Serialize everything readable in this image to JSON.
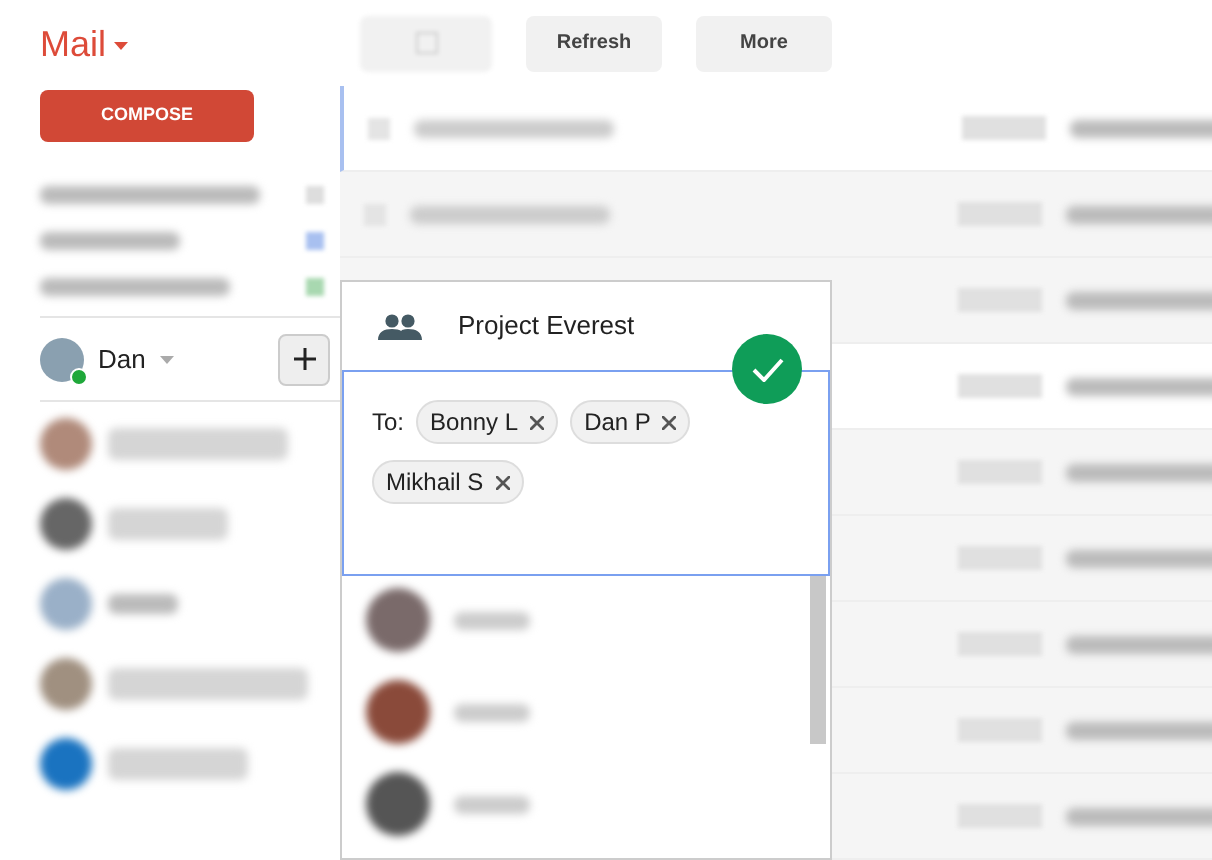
{
  "app": {
    "title": "Mail"
  },
  "compose_button": "COMPOSE",
  "toolbar": {
    "buttons": [
      "Refresh",
      "More"
    ]
  },
  "chat": {
    "user": {
      "name": "Dan",
      "online": true
    }
  },
  "group_popup": {
    "title": "Project Everest",
    "to_label": "To:",
    "confirmed": true,
    "recipients": [
      {
        "name": "Bonny L"
      },
      {
        "name": "Dan P"
      },
      {
        "name": "Mikhail S"
      }
    ]
  }
}
